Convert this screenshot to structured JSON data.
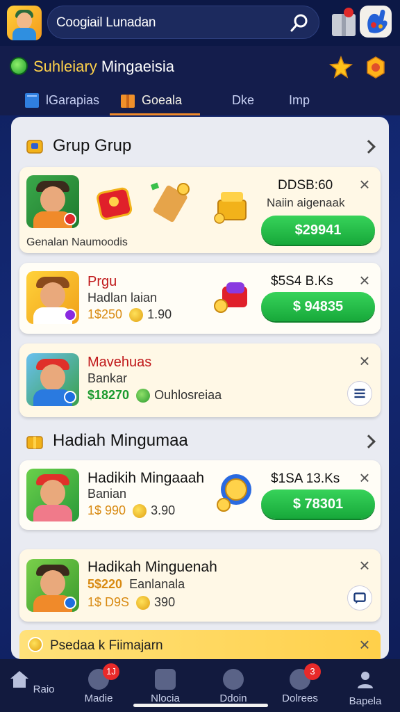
{
  "search": {
    "text": "Coogiail Lunadan"
  },
  "header": {
    "brand_yellow": "Suhleiary",
    "brand_white": "Mingaeisia",
    "tabs": [
      {
        "label": "lGarapias"
      },
      {
        "label": "Goeala"
      },
      {
        "label": "Dke"
      },
      {
        "label": "Imp"
      }
    ]
  },
  "section1": {
    "title": "Grup Grup",
    "card1": {
      "price_label": "DDSB:60",
      "sub_label": "Naiin aigenaak",
      "button": "$29941",
      "caption": "Genalan Naumoodis"
    },
    "card2": {
      "title": "Prgu",
      "sub": "Hadlan laian",
      "price": "1$250",
      "coin_value": "1.90",
      "price_label": "$5S4 B.Ks",
      "button": "$ 94835"
    },
    "card3": {
      "title": "Mavehuas",
      "sub": "Bankar",
      "price": "$18270",
      "extra": "Ouhlosreiaa"
    }
  },
  "section2": {
    "title": "Hadiah Mingumaa",
    "card4": {
      "title": "Hadikih Mingaaah",
      "sub": "Banian",
      "price": "1$ 990",
      "coin_value": "3.90",
      "price_label": "$1SA 13.Ks",
      "button": "$ 78301"
    },
    "card5": {
      "title": "Hadikah Minguenah",
      "price_small": "5$220",
      "sub": "Eanlanala",
      "price": "1$ D9S",
      "coin_value": "390"
    }
  },
  "bottom_strip": {
    "label": "Psedaa k Fiimajarn"
  },
  "nav": {
    "items": [
      {
        "label": "Raio"
      },
      {
        "label": "Madie",
        "badge": "1J"
      },
      {
        "label": "Nlocia"
      },
      {
        "label": "Ddoin"
      },
      {
        "label": "Dolrees",
        "badge": "3"
      },
      {
        "label": "Bapela"
      }
    ]
  },
  "colors": {
    "accent_green": "#1fb445",
    "tab_underline": "#f08a2a",
    "title_red": "#c0181a"
  }
}
